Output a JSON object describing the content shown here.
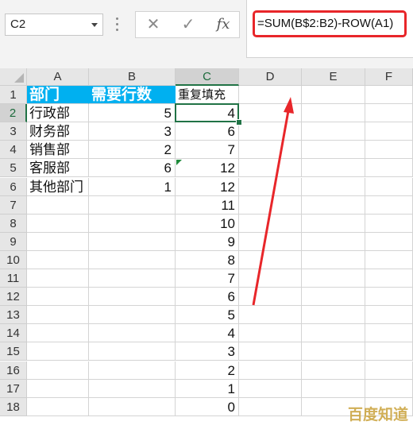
{
  "name_box": {
    "value": "C2"
  },
  "toolbar": {
    "cancel_glyph": "✕",
    "enter_glyph": "✓",
    "fx_label": "fx"
  },
  "formula_bar": {
    "value": "=SUM(B$2:B2)-ROW(A1)",
    "highlight_color": "#e8262a"
  },
  "columns": [
    "A",
    "B",
    "C",
    "D",
    "E",
    "F"
  ],
  "rows": [
    "1",
    "2",
    "3",
    "4",
    "5",
    "6",
    "7",
    "8",
    "9",
    "10",
    "11",
    "12",
    "13",
    "14",
    "15",
    "16",
    "17",
    "18"
  ],
  "header_row": {
    "a": "部门",
    "b": "需要行数",
    "c": "重复填充",
    "fill_color": "#00b0f0"
  },
  "data_rows": [
    {
      "a": "行政部",
      "b": "5",
      "c": "4"
    },
    {
      "a": "财务部",
      "b": "3",
      "c": "6"
    },
    {
      "a": "销售部",
      "b": "2",
      "c": "7"
    },
    {
      "a": "客服部",
      "b": "6",
      "c": "12"
    },
    {
      "a": "其他部门",
      "b": "1",
      "c": "12"
    },
    {
      "a": "",
      "b": "",
      "c": "11"
    },
    {
      "a": "",
      "b": "",
      "c": "10"
    },
    {
      "a": "",
      "b": "",
      "c": "9"
    },
    {
      "a": "",
      "b": "",
      "c": "8"
    },
    {
      "a": "",
      "b": "",
      "c": "7"
    },
    {
      "a": "",
      "b": "",
      "c": "6"
    },
    {
      "a": "",
      "b": "",
      "c": "5"
    },
    {
      "a": "",
      "b": "",
      "c": "4"
    },
    {
      "a": "",
      "b": "",
      "c": "3"
    },
    {
      "a": "",
      "b": "",
      "c": "2"
    },
    {
      "a": "",
      "b": "",
      "c": "1"
    },
    {
      "a": "",
      "b": "",
      "c": "0"
    }
  ],
  "annotation": {
    "arrow_color": "#e8262a"
  },
  "watermark": {
    "text": "百度知道"
  }
}
